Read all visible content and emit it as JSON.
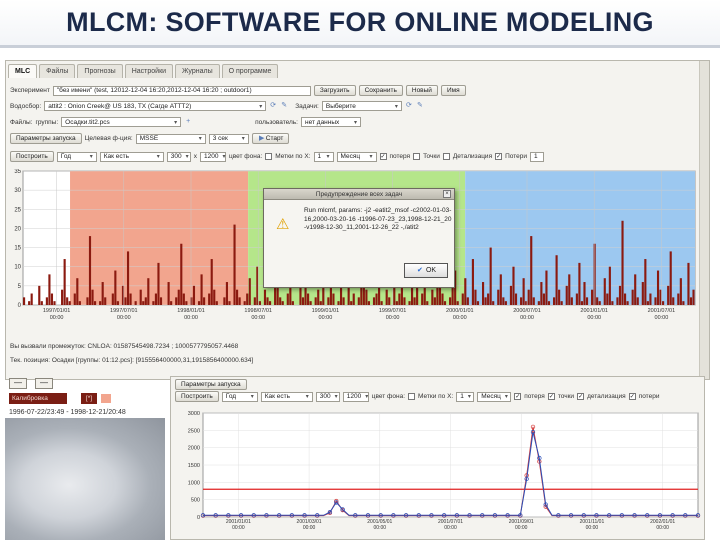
{
  "slide": {
    "title": "MLCM: SOFTWARE FOR ONLINE MODELING"
  },
  "app": {
    "tabs": [
      "MLC",
      "Файлы",
      "Прогнозы",
      "Настройки",
      "Журналы",
      "О программе"
    ],
    "experiment": {
      "label": "Эксперимент",
      "value": "\"без имени\" (test, 12012-12-04 16:20,2012-12-04 16:20 ; outdoor1)"
    },
    "buttons": {
      "load": "Загрузить",
      "save": "Сохранить",
      "new": "Новый",
      "name": "Имя",
      "start": "Старт",
      "launch_params": "Параметры запуска"
    },
    "basin": {
      "label": "Водосбор:",
      "value": "attit2 : Onion Creek@ US 183, TX (Сагде ATTT2)"
    },
    "task": {
      "label": "Задачи:",
      "value": "Выберите"
    },
    "files": {
      "label": "Файлы:",
      "group_label": "группы:",
      "group_value": "Осадки.tit2.pcs",
      "user_label": "пользователь:",
      "user_value": "нет данных"
    },
    "target": {
      "label": "Целевая ф-ция:",
      "value": "MSSE"
    },
    "interval": "3 сек",
    "plot_row": {
      "build": "Построить",
      "period": "Год",
      "mode": "Как есть",
      "width": "300",
      "x": "x",
      "height": "1200",
      "bg_label": "цвет фона:",
      "mark_x": "Метки по X:",
      "mark_x_value": "1",
      "month": "Месяц",
      "legend_loss": "потеря",
      "legend_points": "Точки",
      "legend_detail": "Детализация",
      "legend_losses": "Потери",
      "last": "1"
    }
  },
  "dialog": {
    "title": "Предупреждение всех задач",
    "message": "Run mlcmf, params: -j2 -eatit2_msof -c2002-01-03-16,2000-03-20-16 -t1996-07-23_23,1998-12-21_20 -v1998-12-30_11,2001-12-26_22 -,/atit2",
    "ok": "OK"
  },
  "status": {
    "line1": "Вы вызвали промежуток: CNLOA: 01587545498.7234 ; 1000577795057.4468",
    "line2": "Тек. позиция: Осадки [группы: 01:12.pcs]: [915556400000,31,1915856400000.634]"
  },
  "bottom_left": {
    "minus": "—",
    "calibration": "Калибровка",
    "marker": "[*]",
    "date_range": "1996-07-22/23:49 - 1998-12-21/20:48"
  },
  "bottom_panel": {
    "launch": "Параметры запуска",
    "build": "Построить",
    "period": "Год",
    "mode": "Как есть",
    "width": "300",
    "height": "1200",
    "bg_label": "цвет фона:",
    "mark_x": "Метки по X:",
    "mark_x_value": "1",
    "month": "Месяц",
    "legend_loss": "потеря",
    "legend_points": "точки",
    "legend_detail": "детализация",
    "legend_losses": "потери"
  },
  "chart_data": [
    {
      "type": "bar",
      "title": "",
      "ylim": [
        0,
        35
      ],
      "yticks": [
        0,
        5,
        10,
        15,
        20,
        25,
        30,
        35
      ],
      "xticks": [
        "1997/01/01\n00:00",
        "1997/07/01\n00:00",
        "1998/01/01\n00:00",
        "1998/07/01\n00:00",
        "1999/01/01\n00:00",
        "1999/07/01\n00:00",
        "2000/01/01\n00:00",
        "2000/07/01\n00:00",
        "2001/01/01\n00:00",
        "2001/07/01\n00:00"
      ],
      "regions": [
        {
          "name": "calibration",
          "color": "#f2a58e",
          "start": 0.07,
          "end": 0.335
        },
        {
          "name": "verification",
          "color": "#b5e68a",
          "start": 0.335,
          "end": 0.658
        },
        {
          "name": "testing",
          "color": "#9cc8f0",
          "start": 0.658,
          "end": 1.0
        }
      ],
      "series_color": "#8b1a10",
      "values": [
        2,
        0,
        1,
        3,
        0,
        0,
        5,
        1,
        0,
        2,
        8,
        3,
        1,
        0,
        0,
        4,
        12,
        2,
        1,
        0,
        3,
        7,
        1,
        0,
        0,
        2,
        18,
        4,
        1,
        0,
        1,
        6,
        2,
        0,
        0,
        3,
        9,
        1,
        0,
        5,
        2,
        14,
        3,
        0,
        1,
        0,
        4,
        1,
        2,
        7,
        0,
        1,
        3,
        11,
        2,
        0,
        0,
        6,
        1,
        0,
        2,
        4,
        16,
        3,
        1,
        0,
        2,
        5,
        0,
        1,
        8,
        2,
        0,
        3,
        12,
        4,
        1,
        0,
        0,
        2,
        6,
        1,
        0,
        21,
        4,
        2,
        0,
        1,
        3,
        7,
        0,
        2,
        10,
        1,
        0,
        4,
        2,
        1,
        0,
        6,
        15,
        2,
        1,
        0,
        3,
        8,
        1,
        0,
        0,
        5,
        2,
        19,
        3,
        1,
        0,
        2,
        4,
        1,
        7,
        0,
        2,
        13,
        3,
        0,
        1,
        5,
        2,
        0,
        9,
        1,
        3,
        0,
        2,
        6,
        17,
        4,
        1,
        0,
        2,
        3,
        10,
        1,
        0,
        4,
        2,
        0,
        7,
        1,
        3,
        14,
        2,
        0,
        1,
        5,
        2,
        8,
        0,
        3,
        11,
        1,
        0,
        4,
        2,
        6,
        20,
        3,
        1,
        0,
        2,
        5,
        9,
        1,
        0,
        3,
        7,
        2,
        0,
        12,
        4,
        1,
        0,
        6,
        2,
        3,
        15,
        1,
        0,
        4,
        8,
        2,
        1,
        0,
        5,
        10,
        3,
        0,
        2,
        7,
        1,
        4,
        18,
        2,
        0,
        1,
        6,
        3,
        9,
        1,
        0,
        2,
        13,
        4,
        1,
        0,
        5,
        8,
        2,
        0,
        3,
        11,
        1,
        6,
        2,
        0,
        4,
        16,
        2,
        1,
        0,
        7,
        3,
        10,
        1,
        0,
        2,
        5,
        22,
        3,
        1,
        0,
        4,
        8,
        2,
        0,
        6,
        12,
        1,
        3,
        0,
        2,
        9,
        4,
        1,
        0,
        5,
        14,
        2,
        0,
        3,
        7,
        1,
        0,
        11,
        2,
        4
      ]
    },
    {
      "type": "line",
      "ylim": [
        0,
        3000
      ],
      "yticks": [
        0,
        500,
        1000,
        1500,
        2000,
        2500,
        3000
      ],
      "threshold": 800,
      "xticks": [
        "2001/01/01\n00:00",
        "2001/03/01\n00:00",
        "2001/05/01\n00:00",
        "2001/07/01\n00:00",
        "2001/09/01\n00:00",
        "2001/11/01\n00:00",
        "2002/01/01\n00:00"
      ],
      "series": [
        {
          "color": "#d43a3a",
          "values": [
            40,
            40,
            40,
            40,
            40,
            40,
            40,
            40,
            40,
            40,
            40,
            40,
            40,
            40,
            40,
            40,
            40,
            40,
            40,
            40,
            120,
            460,
            200,
            40,
            40,
            40,
            40,
            40,
            40,
            40,
            40,
            40,
            40,
            40,
            40,
            40,
            40,
            40,
            40,
            40,
            40,
            40,
            40,
            40,
            40,
            40,
            40,
            40,
            40,
            40,
            40,
            1200,
            2600,
            1600,
            300,
            40,
            40,
            40,
            40,
            40,
            40,
            40,
            40,
            40,
            40,
            40,
            40,
            40,
            40,
            40,
            40,
            40,
            40,
            40,
            40,
            40,
            40,
            40,
            40
          ]
        },
        {
          "color": "#2a4fb8",
          "values": [
            50,
            50,
            50,
            50,
            50,
            50,
            50,
            50,
            50,
            50,
            50,
            50,
            50,
            50,
            50,
            50,
            50,
            50,
            50,
            50,
            140,
            420,
            220,
            50,
            50,
            50,
            50,
            50,
            50,
            50,
            50,
            50,
            50,
            50,
            50,
            50,
            50,
            50,
            50,
            50,
            50,
            50,
            50,
            50,
            50,
            50,
            50,
            50,
            50,
            50,
            50,
            1100,
            2450,
            1700,
            360,
            50,
            50,
            50,
            50,
            50,
            50,
            50,
            50,
            50,
            50,
            50,
            50,
            50,
            50,
            50,
            50,
            50,
            50,
            50,
            50,
            50,
            50,
            50,
            50
          ]
        }
      ]
    }
  ]
}
